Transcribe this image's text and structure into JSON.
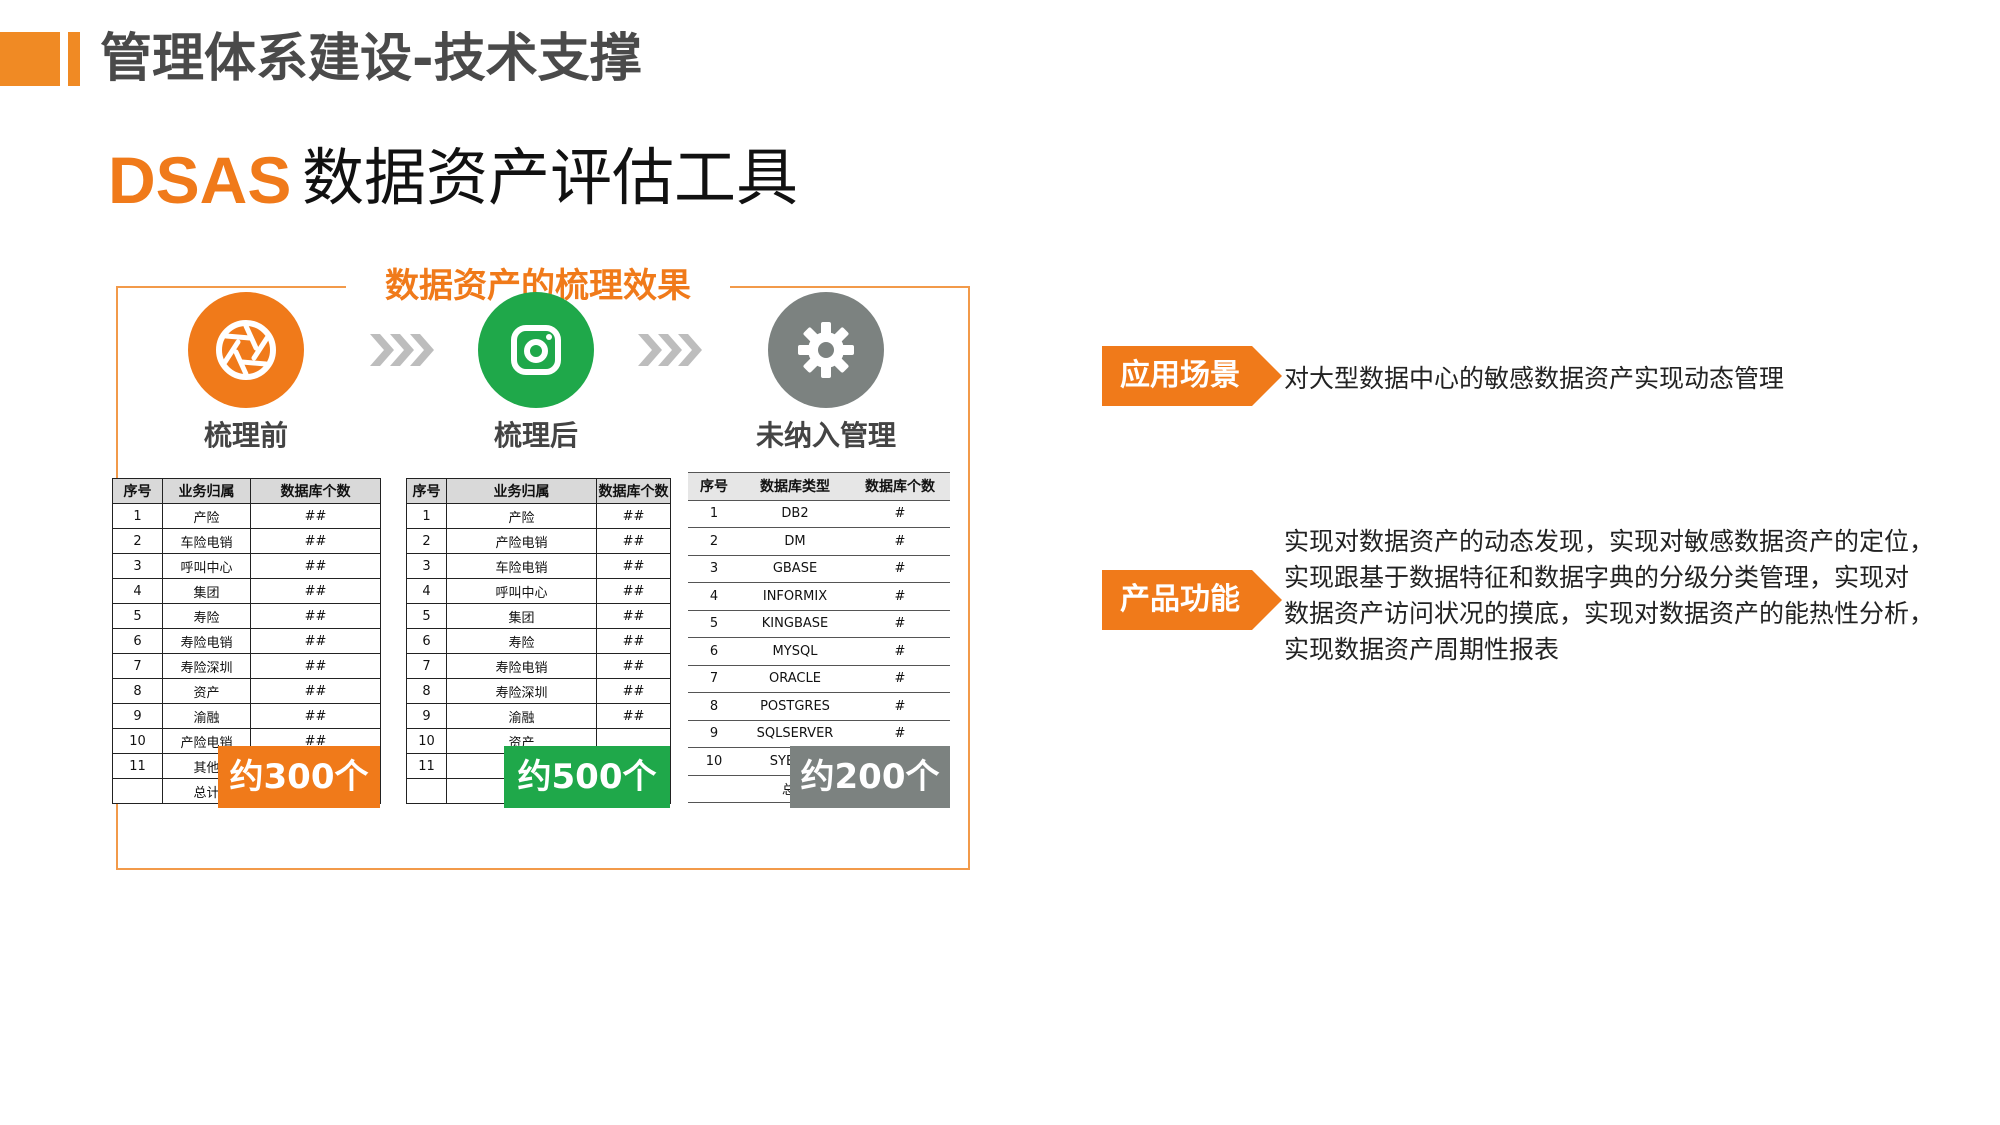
{
  "header": {
    "title": "管理体系建设-技术支撑"
  },
  "heading": {
    "brand": "DSAS",
    "subtitle": "数据资产评估工具"
  },
  "panel": {
    "title": "数据资产的梳理效果",
    "stages": [
      {
        "label": "梳理前",
        "count": "约300个",
        "icon": "aperture-icon",
        "color": "#f07a1a"
      },
      {
        "label": "梳理后",
        "count": "约500个",
        "icon": "camera-icon",
        "color": "#1fa84a"
      },
      {
        "label": "未纳入管理",
        "count": "约200个",
        "icon": "gear-icon",
        "color": "#7c8280"
      }
    ],
    "table1": {
      "headers": [
        "序号",
        "业务归属",
        "数据库个数"
      ],
      "rows": [
        [
          "1",
          "产险",
          "##"
        ],
        [
          "2",
          "车险电销",
          "##"
        ],
        [
          "3",
          "呼叫中心",
          "##"
        ],
        [
          "4",
          "集团",
          "##"
        ],
        [
          "5",
          "寿险",
          "##"
        ],
        [
          "6",
          "寿险电销",
          "##"
        ],
        [
          "7",
          "寿险深圳",
          "##"
        ],
        [
          "8",
          "资产",
          "##"
        ],
        [
          "9",
          "渝融",
          "##"
        ],
        [
          "10",
          "产险电销",
          "##"
        ],
        [
          "11",
          "其他",
          "##"
        ],
        [
          "",
          "总计",
          ""
        ]
      ]
    },
    "table2": {
      "headers": [
        "序号",
        "业务归属",
        "数据库个数"
      ],
      "rows": [
        [
          "1",
          "产险",
          "##"
        ],
        [
          "2",
          "产险电销",
          "##"
        ],
        [
          "3",
          "车险电销",
          "##"
        ],
        [
          "4",
          "呼叫中心",
          "##"
        ],
        [
          "5",
          "集团",
          "##"
        ],
        [
          "6",
          "寿险",
          "##"
        ],
        [
          "7",
          "寿险电销",
          "##"
        ],
        [
          "8",
          "寿险深圳",
          "##"
        ],
        [
          "9",
          "渝融",
          "##"
        ],
        [
          "10",
          "资产",
          ""
        ],
        [
          "11",
          "",
          ""
        ],
        [
          "",
          "",
          ""
        ]
      ]
    },
    "table3": {
      "headers": [
        "序号",
        "数据库类型",
        "数据库个数"
      ],
      "rows": [
        [
          "1",
          "DB2",
          "#"
        ],
        [
          "2",
          "DM",
          "#"
        ],
        [
          "3",
          "GBASE",
          "#"
        ],
        [
          "4",
          "INFORMIX",
          "#"
        ],
        [
          "5",
          "KINGBASE",
          "#"
        ],
        [
          "6",
          "MYSQL",
          "#"
        ],
        [
          "7",
          "ORACLE",
          "#"
        ],
        [
          "8",
          "POSTGRES",
          "#"
        ],
        [
          "9",
          "SQLSERVER",
          "#"
        ],
        [
          "10",
          "SYBASE",
          ""
        ],
        [
          "",
          "总计",
          ""
        ]
      ]
    }
  },
  "info": {
    "scenario_label": "应用场景",
    "scenario_text": "对大型数据中心的敏感数据资产实现动态管理",
    "function_label": "产品功能",
    "function_lines": [
      "实现对数据资产的动态发现，实现对敏感数据资产的定位，",
      "实现跟基于数据特征和数据字典的分级分类管理，实现对",
      "数据资产访问状况的摸底，实现对数据资产的能热性分析，",
      "实现数据资产周期性报表"
    ]
  }
}
